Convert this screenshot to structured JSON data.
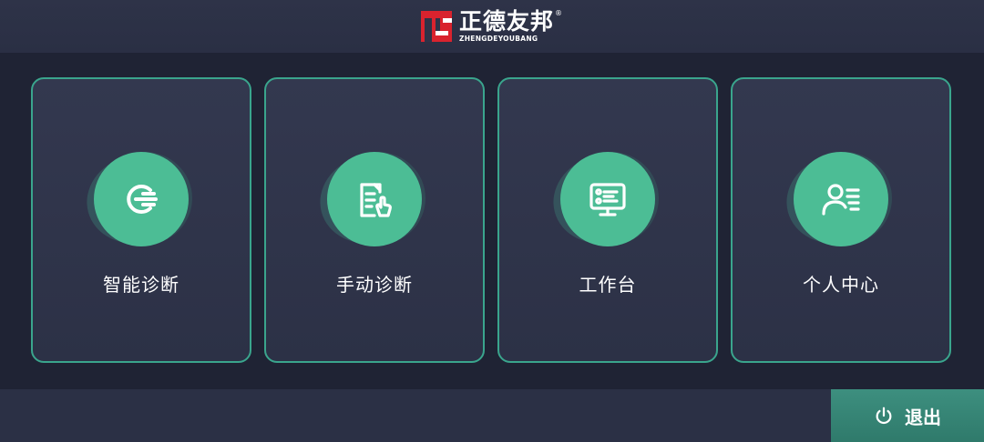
{
  "header": {
    "logo_cn": "正德友邦",
    "logo_registered": "®",
    "logo_en": "ZHENGDEYOUBANG",
    "logo_icon": "brand-logo-icon"
  },
  "cards": [
    {
      "label": "智能诊断",
      "icon": "smart-diagnosis-icon"
    },
    {
      "label": "手动诊断",
      "icon": "manual-diagnosis-icon"
    },
    {
      "label": "工作台",
      "icon": "workbench-icon"
    },
    {
      "label": "个人中心",
      "icon": "personal-center-icon"
    }
  ],
  "footer": {
    "exit_label": "退出",
    "exit_icon": "power-icon"
  },
  "colors": {
    "accent": "#4cbd95",
    "card_border": "#3aa58d",
    "background": "#1f2334",
    "logo_red": "#d9232e"
  }
}
